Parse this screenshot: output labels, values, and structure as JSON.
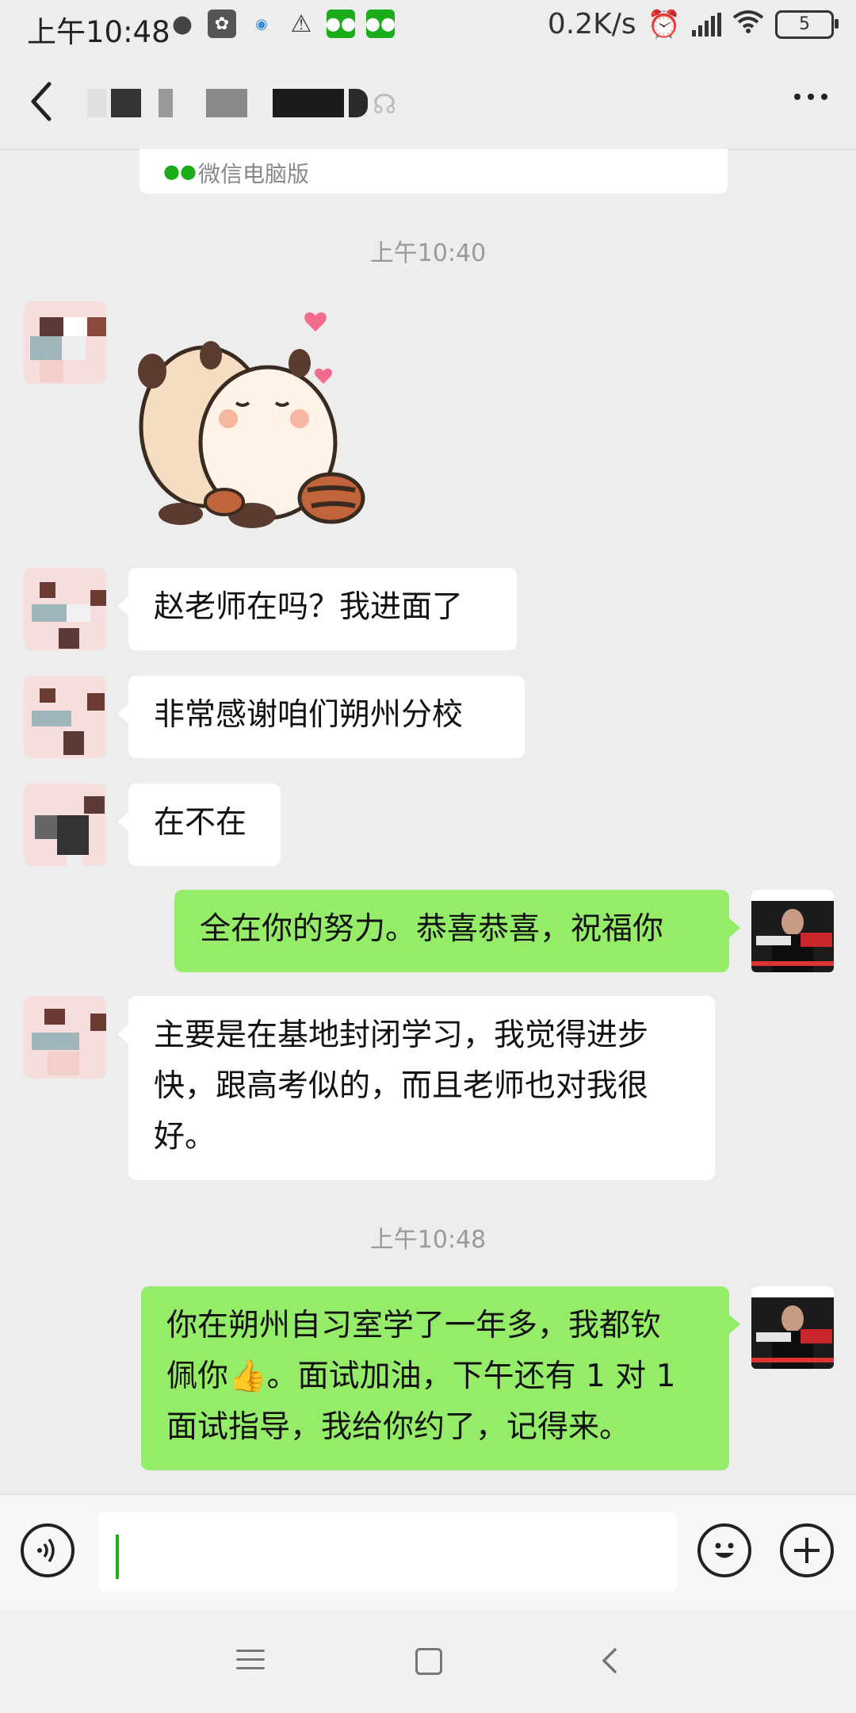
{
  "status_bar": {
    "time": "上午10:48",
    "net_speed": "0.2K/s",
    "battery": "5",
    "icons": [
      "wechat-notification-icon",
      "app-icon",
      "notification-dot-icon",
      "warning-icon",
      "wechat-icon",
      "wechat-icon"
    ]
  },
  "header": {
    "back_icon": "chevron-left-icon",
    "title": "",
    "mute_icon": "ear-icon",
    "more_icon": "more-dots-icon"
  },
  "card": {
    "label": "微信电脑版"
  },
  "messages": [
    {
      "type": "timestamp",
      "text": "上午10:40"
    },
    {
      "type": "sticker",
      "from": "other",
      "description": "two hugging raccoon stickers"
    },
    {
      "type": "text",
      "from": "other",
      "text": "赵老师在吗？我进面了"
    },
    {
      "type": "text",
      "from": "other",
      "text": "非常感谢咱们朔州分校"
    },
    {
      "type": "text",
      "from": "other",
      "text": "在不在"
    },
    {
      "type": "text",
      "from": "me",
      "text": "全在你的努力。恭喜恭喜，祝福你"
    },
    {
      "type": "text",
      "from": "other",
      "lines": [
        "主要是在基地封闭学习，我觉得进步",
        "快，跟高考似的，而且老师也对我很",
        "好。"
      ]
    },
    {
      "type": "timestamp",
      "text": "上午10:48"
    },
    {
      "type": "text",
      "from": "me",
      "lines_a": [
        "你在朔州自习室学了一年多，我都钦",
        "佩你"
      ],
      "emoji": "👍",
      "lines_b": [
        "。面试加油，下午还有 1 对 1",
        "面试指导，我给你约了，记得来。"
      ]
    }
  ],
  "input": {
    "value": "",
    "placeholder": ""
  },
  "colors": {
    "bg": "#ededed",
    "out_bubble": "#95ec69",
    "in_bubble": "#ffffff",
    "accent": "#1aad19"
  }
}
